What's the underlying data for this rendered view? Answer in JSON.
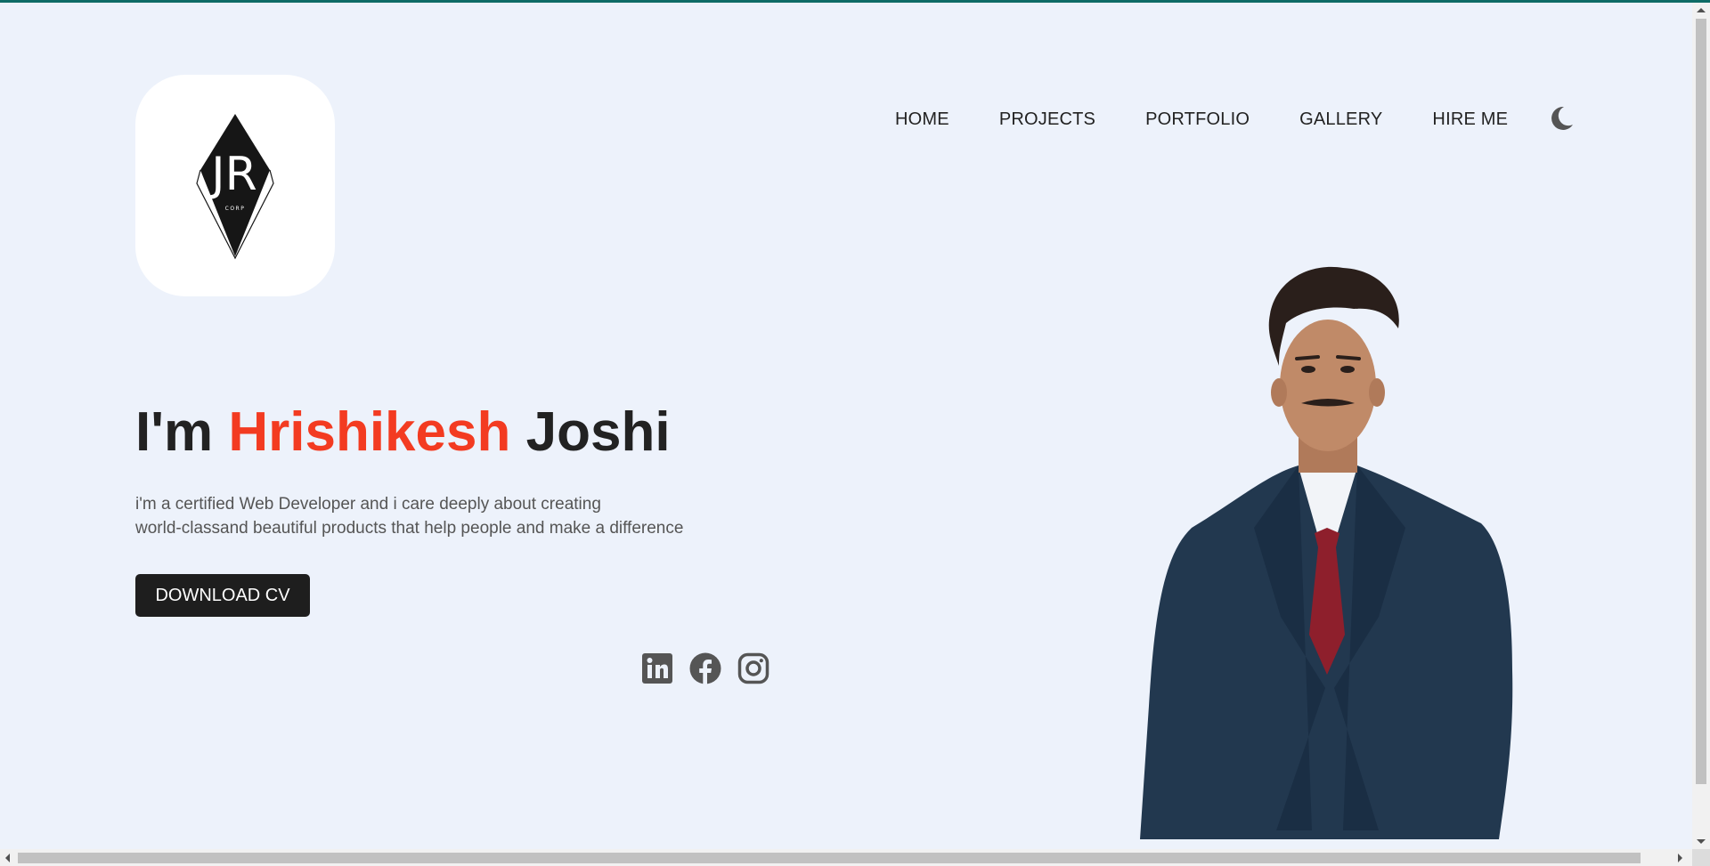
{
  "logo": {
    "monogram": "JR",
    "tagline": "CORP"
  },
  "nav": {
    "items": [
      "HOME",
      "PROJECTS",
      "PORTFOLIO",
      "GALLERY",
      "HIRE ME"
    ],
    "theme_toggle_icon": "moon-icon"
  },
  "hero": {
    "greeting": "I'm",
    "first_name": "Hrishikesh",
    "last_name": "Joshi",
    "description_line1": "i'm a certified Web Developer and i care deeply about creating",
    "description_line2": "world-classand beautiful products that help people and make a difference",
    "cta_label": "DOWNLOAD CV",
    "socials": [
      "linkedin-icon",
      "facebook-icon",
      "instagram-icon"
    ]
  },
  "colors": {
    "accent": "#f33b21",
    "background": "#edf2fb",
    "text": "#222222",
    "button": "#1e1e1e"
  }
}
